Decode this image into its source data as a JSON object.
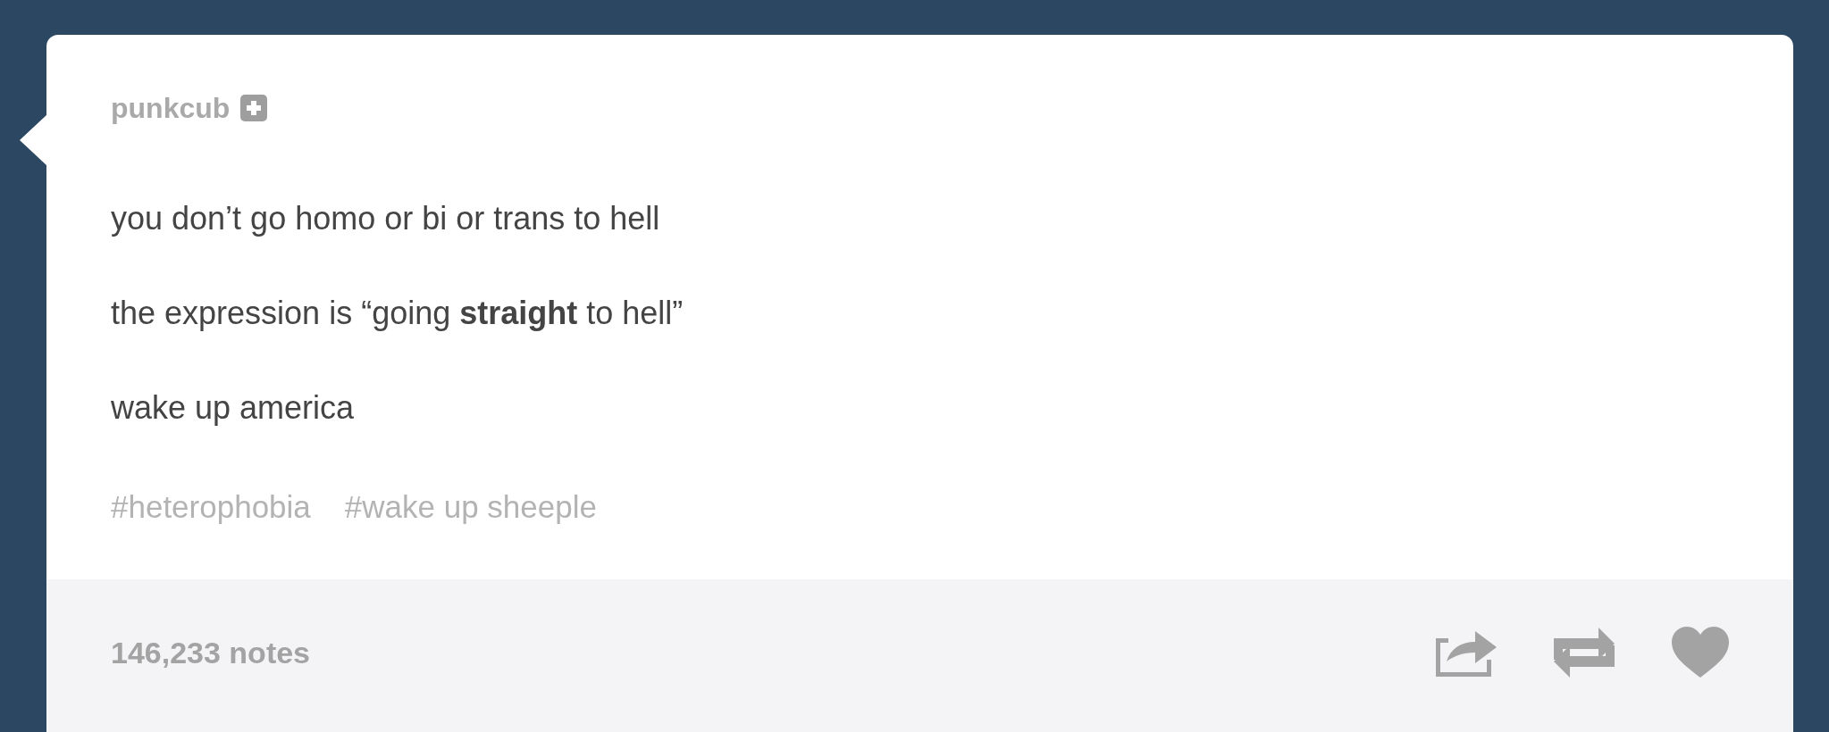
{
  "post": {
    "username": "punkcub",
    "paragraphs": [
      "you don’t go homo or bi or trans to hell",
      "the expression is “going **straight** to hell”",
      "wake up america"
    ],
    "tags": [
      "#heterophobia",
      "#wake up sheeple"
    ],
    "notes": "146,233 notes",
    "liked": false
  }
}
